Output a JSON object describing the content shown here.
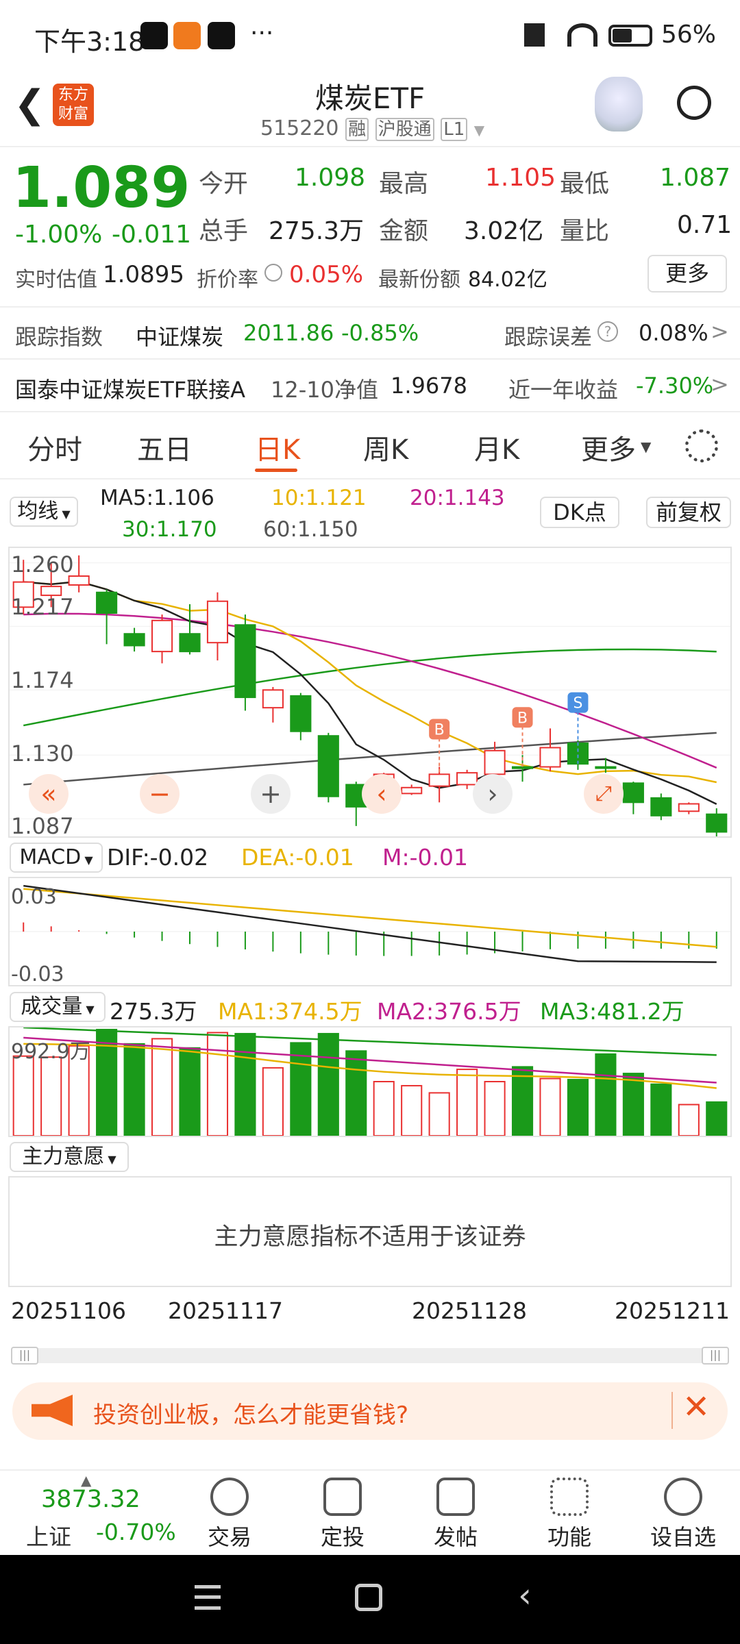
{
  "status": {
    "time": "下午3:18",
    "more": "···",
    "battery": "56%"
  },
  "header": {
    "logo": "东方财富",
    "title": "煤炭ETF",
    "code": "515220",
    "tag1": "融",
    "tag2": "沪股通",
    "tag3": "L1"
  },
  "quote": {
    "price": "1.089",
    "pct": "-1.00%",
    "chg": "-0.011",
    "open_label": "今开",
    "open": "1.098",
    "high_label": "最高",
    "high": "1.105",
    "low_label": "最低",
    "low": "1.087",
    "vol_label": "总手",
    "vol": "275.3万",
    "amt_label": "金额",
    "amt": "3.02亿",
    "ratio_label": "量比",
    "ratio": "0.71",
    "iopv_label": "实时估值",
    "iopv": "1.0895",
    "disc_label": "折价率",
    "disc": "0.05%",
    "share_label": "最新份额",
    "share": "84.02亿",
    "more": "更多",
    "track_label": "跟踪指数",
    "track_name": "中证煤炭",
    "track_val": "2011.86",
    "track_pct": "-0.85%",
    "err_label": "跟踪误差",
    "err": "0.08%",
    "fund_name": "国泰中证煤炭ETF联接A",
    "nav_label": "12-10净值",
    "nav": "1.9678",
    "yr_label": "近一年收益",
    "yr": "-7.30%"
  },
  "tabs": [
    "分时",
    "五日",
    "日K",
    "周K",
    "月K",
    "更多"
  ],
  "ma": {
    "sel": "均线",
    "ma5": "MA5:1.106",
    "ma10": "10:1.121",
    "ma20": "20:1.143",
    "ma30": "30:1.170",
    "ma60": "60:1.150",
    "dk": "DK点",
    "fq": "前复权"
  },
  "kchart": {
    "yticks": [
      "1.260",
      "1.217",
      "1.174",
      "1.130",
      "1.087"
    ],
    "marks": [
      "B",
      "B",
      "S"
    ]
  },
  "macd": {
    "sel": "MACD",
    "dif": "DIF:-0.02",
    "dea": "DEA:-0.01",
    "m": "M:-0.01",
    "top": "0.03",
    "bot": "-0.03"
  },
  "volume": {
    "sel": "成交量",
    "val": "275.3万",
    "ma1": "MA1:374.5万",
    "ma2": "MA2:376.5万",
    "ma3": "MA3:481.2万",
    "top": "992.9万"
  },
  "intent": {
    "sel": "主力意愿",
    "msg": "主力意愿指标不适用于该证券"
  },
  "dates": [
    "20251106",
    "20251117",
    "20251128",
    "20251211"
  ],
  "ad": {
    "text": "投资创业板，怎么才能更省钱?"
  },
  "bottom": {
    "index_val": "3873.32",
    "index_name": "上证",
    "index_pct": "-0.70%",
    "items": [
      "交易",
      "定投",
      "发帖",
      "功能",
      "设自选"
    ]
  },
  "chart_data": {
    "type": "candlestick",
    "candles": [
      {
        "o": 1.23,
        "c": 1.247,
        "h": 1.262,
        "l": 1.225,
        "up": true
      },
      {
        "o": 1.238,
        "c": 1.244,
        "h": 1.26,
        "l": 1.23,
        "up": true
      },
      {
        "o": 1.245,
        "c": 1.251,
        "h": 1.265,
        "l": 1.24,
        "up": true
      },
      {
        "o": 1.24,
        "c": 1.226,
        "h": 1.242,
        "l": 1.205,
        "up": false
      },
      {
        "o": 1.212,
        "c": 1.204,
        "h": 1.216,
        "l": 1.2,
        "up": false
      },
      {
        "o": 1.2,
        "c": 1.221,
        "h": 1.225,
        "l": 1.192,
        "up": true
      },
      {
        "o": 1.212,
        "c": 1.2,
        "h": 1.232,
        "l": 1.198,
        "up": false
      },
      {
        "o": 1.206,
        "c": 1.234,
        "h": 1.24,
        "l": 1.194,
        "up": true
      },
      {
        "o": 1.218,
        "c": 1.169,
        "h": 1.225,
        "l": 1.16,
        "up": false
      },
      {
        "o": 1.162,
        "c": 1.174,
        "h": 1.176,
        "l": 1.152,
        "up": true
      },
      {
        "o": 1.17,
        "c": 1.146,
        "h": 1.172,
        "l": 1.14,
        "up": false
      },
      {
        "o": 1.143,
        "c": 1.102,
        "h": 1.145,
        "l": 1.098,
        "up": false
      },
      {
        "o": 1.11,
        "c": 1.095,
        "h": 1.112,
        "l": 1.082,
        "up": false
      },
      {
        "o": 1.103,
        "c": 1.117,
        "h": 1.118,
        "l": 1.101,
        "up": true
      },
      {
        "o": 1.104,
        "c": 1.108,
        "h": 1.11,
        "l": 1.103,
        "up": true
      },
      {
        "o": 1.109,
        "c": 1.117,
        "h": 1.122,
        "l": 1.098,
        "up": true
      },
      {
        "o": 1.11,
        "c": 1.118,
        "h": 1.12,
        "l": 1.107,
        "up": true
      },
      {
        "o": 1.117,
        "c": 1.133,
        "h": 1.139,
        "l": 1.108,
        "up": true
      },
      {
        "o": 1.121,
        "c": 1.122,
        "h": 1.13,
        "l": 1.112,
        "up": false
      },
      {
        "o": 1.122,
        "c": 1.135,
        "h": 1.148,
        "l": 1.119,
        "up": true
      },
      {
        "o": 1.138,
        "c": 1.124,
        "h": 1.14,
        "l": 1.12,
        "up": false
      },
      {
        "o": 1.122,
        "c": 1.122,
        "h": 1.128,
        "l": 1.118,
        "up": false
      },
      {
        "o": 1.111,
        "c": 1.098,
        "h": 1.112,
        "l": 1.09,
        "up": false
      },
      {
        "o": 1.101,
        "c": 1.089,
        "h": 1.104,
        "l": 1.086,
        "up": false
      },
      {
        "o": 1.092,
        "c": 1.097,
        "h": 1.098,
        "l": 1.09,
        "up": true
      },
      {
        "o": 1.09,
        "c": 1.078,
        "h": 1.094,
        "l": 1.073,
        "up": false
      }
    ],
    "volumes": [
      780,
      770,
      880,
      1040,
      900,
      950,
      860,
      1010,
      1000,
      665,
      910,
      1000,
      830,
      530,
      490,
      420,
      650,
      530,
      675,
      560,
      550,
      800,
      610,
      505,
      305,
      330
    ]
  }
}
